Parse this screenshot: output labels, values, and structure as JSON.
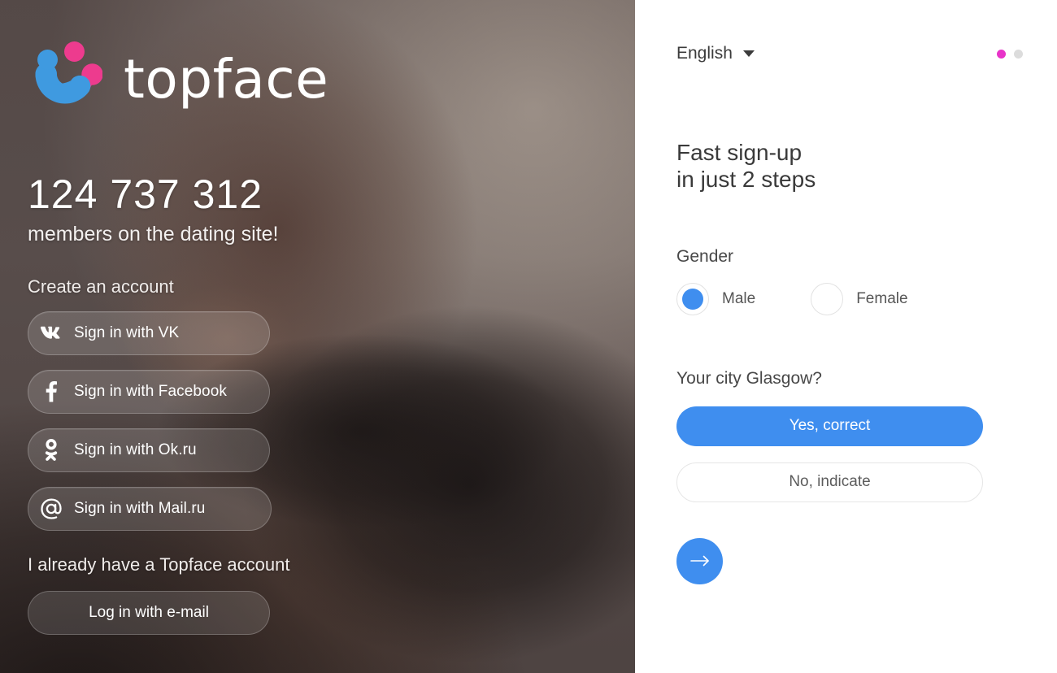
{
  "promo": {
    "brand_name": "topface",
    "logo_icon": "topface-smiley-logo",
    "member_count": "124 737 312",
    "member_caption": "members on the dating site!",
    "create_account_label": "Create an account",
    "social_buttons": [
      {
        "label": "Sign in with VK",
        "icon": "vk-icon"
      },
      {
        "label": "Sign in with Facebook",
        "icon": "facebook-icon"
      },
      {
        "label": "Sign in with Ok.ru",
        "icon": "odnoklassniki-icon"
      },
      {
        "label": "Sign in with Mail.ru",
        "icon": "mailru-at-icon"
      }
    ],
    "existing_account_label": "I already have a Topface account",
    "login_button_label": "Log in with e-mail"
  },
  "form": {
    "language": "English",
    "language_caret_icon": "chevron-down-icon",
    "steps": {
      "total": 2,
      "current": 1
    },
    "title_line1": "Fast sign-up",
    "title_line2": "in just 2 steps",
    "gender": {
      "label": "Gender",
      "options": [
        {
          "label": "Male",
          "selected": true
        },
        {
          "label": "Female",
          "selected": false
        }
      ]
    },
    "city": {
      "label": "Your city Glasgow?",
      "confirm_label": "Yes, correct",
      "decline_label": "No, indicate"
    },
    "next_button_icon": "arrow-right-icon"
  },
  "colors": {
    "accent_blue": "#3f8eef",
    "accent_pink": "#e833c9",
    "logo_blue": "#3f9ae0",
    "logo_pink": "#ed3b8e",
    "step_inactive": "#dcdcdc",
    "panel_background": "#6b5f5e"
  }
}
